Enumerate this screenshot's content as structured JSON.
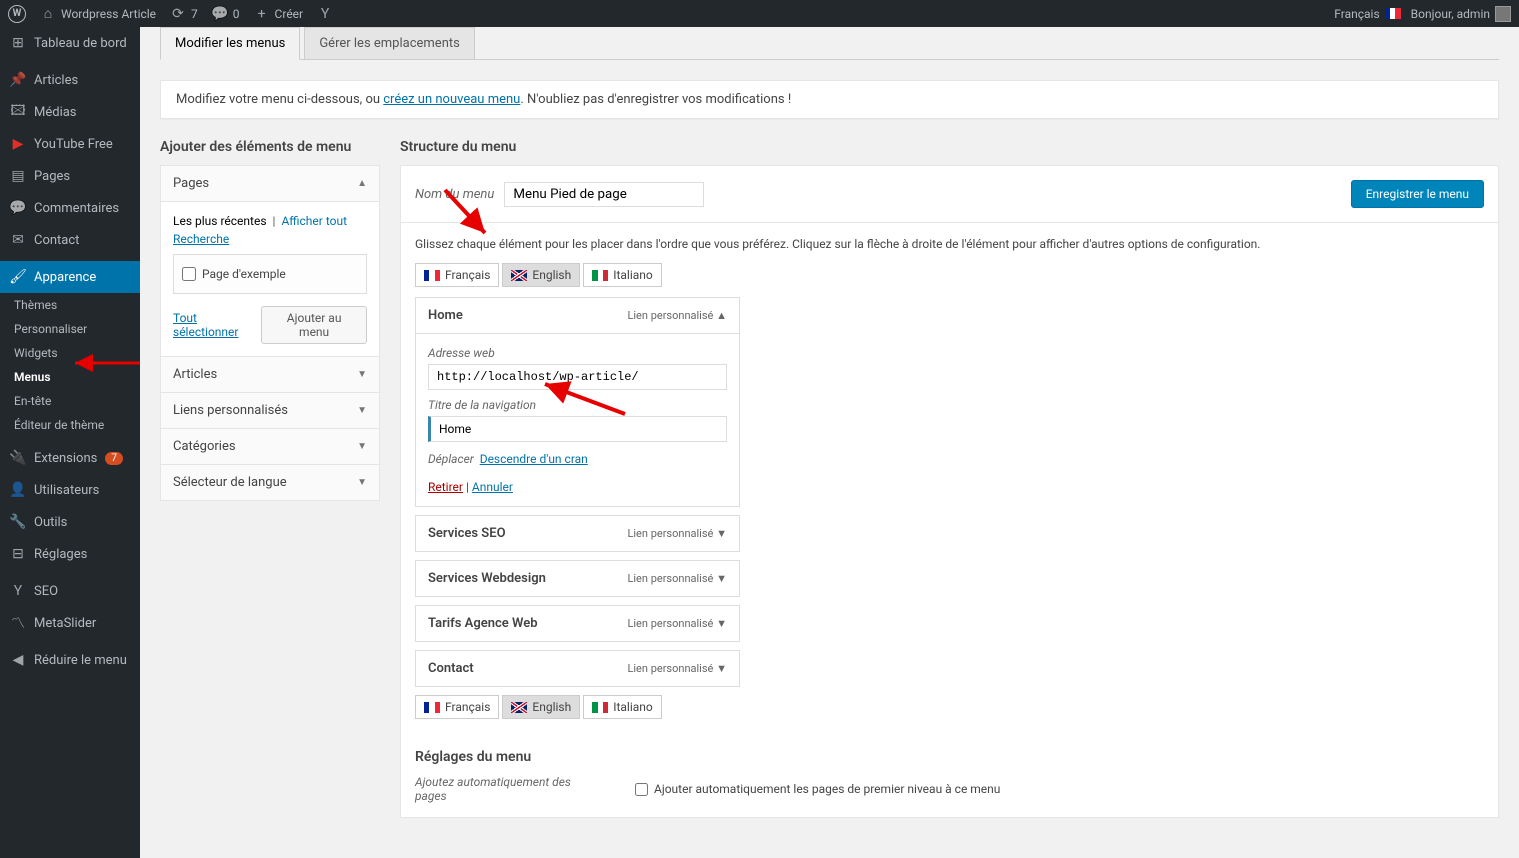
{
  "adminbar": {
    "site": "Wordpress Article",
    "updates": "7",
    "comments": "0",
    "new": "Créer",
    "lang": "Français",
    "greeting": "Bonjour, admin"
  },
  "sidebar": {
    "dashboard": "Tableau de bord",
    "articles": "Articles",
    "media": "Médias",
    "youtube": "YouTube Free",
    "pages": "Pages",
    "comments": "Commentaires",
    "contact": "Contact",
    "appearance": "Apparence",
    "themes": "Thèmes",
    "customize": "Personnaliser",
    "widgets": "Widgets",
    "menus": "Menus",
    "header": "En-tête",
    "editor": "Éditeur de thème",
    "plugins": "Extensions",
    "plugins_count": "7",
    "users": "Utilisateurs",
    "tools": "Outils",
    "settings": "Réglages",
    "seo": "SEO",
    "metaslider": "MetaSlider",
    "collapse": "Réduire le menu"
  },
  "tabs": {
    "edit": "Modifier les menus",
    "manage": "Gérer les emplacements"
  },
  "notice": {
    "pre": "Modifiez votre menu ci-dessous, ou ",
    "link": "créez un nouveau menu",
    "post": ". N'oubliez pas d'enregistrer vos modifications !"
  },
  "left": {
    "title": "Ajouter des éléments de menu",
    "pages": "Pages",
    "recent": "Les plus récentes",
    "viewall": "Afficher tout",
    "search": "Recherche",
    "sample": "Page d'exemple",
    "selectall": "Tout sélectionner",
    "addbtn": "Ajouter au menu",
    "posts": "Articles",
    "links": "Liens personnalisés",
    "cats": "Catégories",
    "langsel": "Sélecteur de langue"
  },
  "right": {
    "title": "Structure du menu",
    "name_label": "Nom du menu",
    "name_value": "Menu Pied de page",
    "save": "Enregistrer le menu",
    "instruction": "Glissez chaque élément pour les placer dans l'ordre que vous préférez. Cliquez sur la flèche à droite de l'élément pour afficher d'autres options de configuration.",
    "lang_fr": "Français",
    "lang_en": "English",
    "lang_it": "Italiano",
    "item_type": "Lien personnalisé",
    "items": [
      {
        "title": "Home",
        "url_label": "Adresse web",
        "url": "http://localhost/wp-article/",
        "nav_label": "Titre de la navigation",
        "nav": "Home",
        "move_label": "Déplacer",
        "move_link": "Descendre d'un cran",
        "remove": "Retirer",
        "cancel": "Annuler"
      },
      {
        "title": "Services SEO"
      },
      {
        "title": "Services Webdesign"
      },
      {
        "title": "Tarifs Agence Web"
      },
      {
        "title": "Contact"
      }
    ],
    "settings_title": "Réglages du menu",
    "auto_label": "Ajoutez automatiquement des pages",
    "auto_check": "Ajouter automatiquement les pages de premier niveau à ce menu"
  }
}
